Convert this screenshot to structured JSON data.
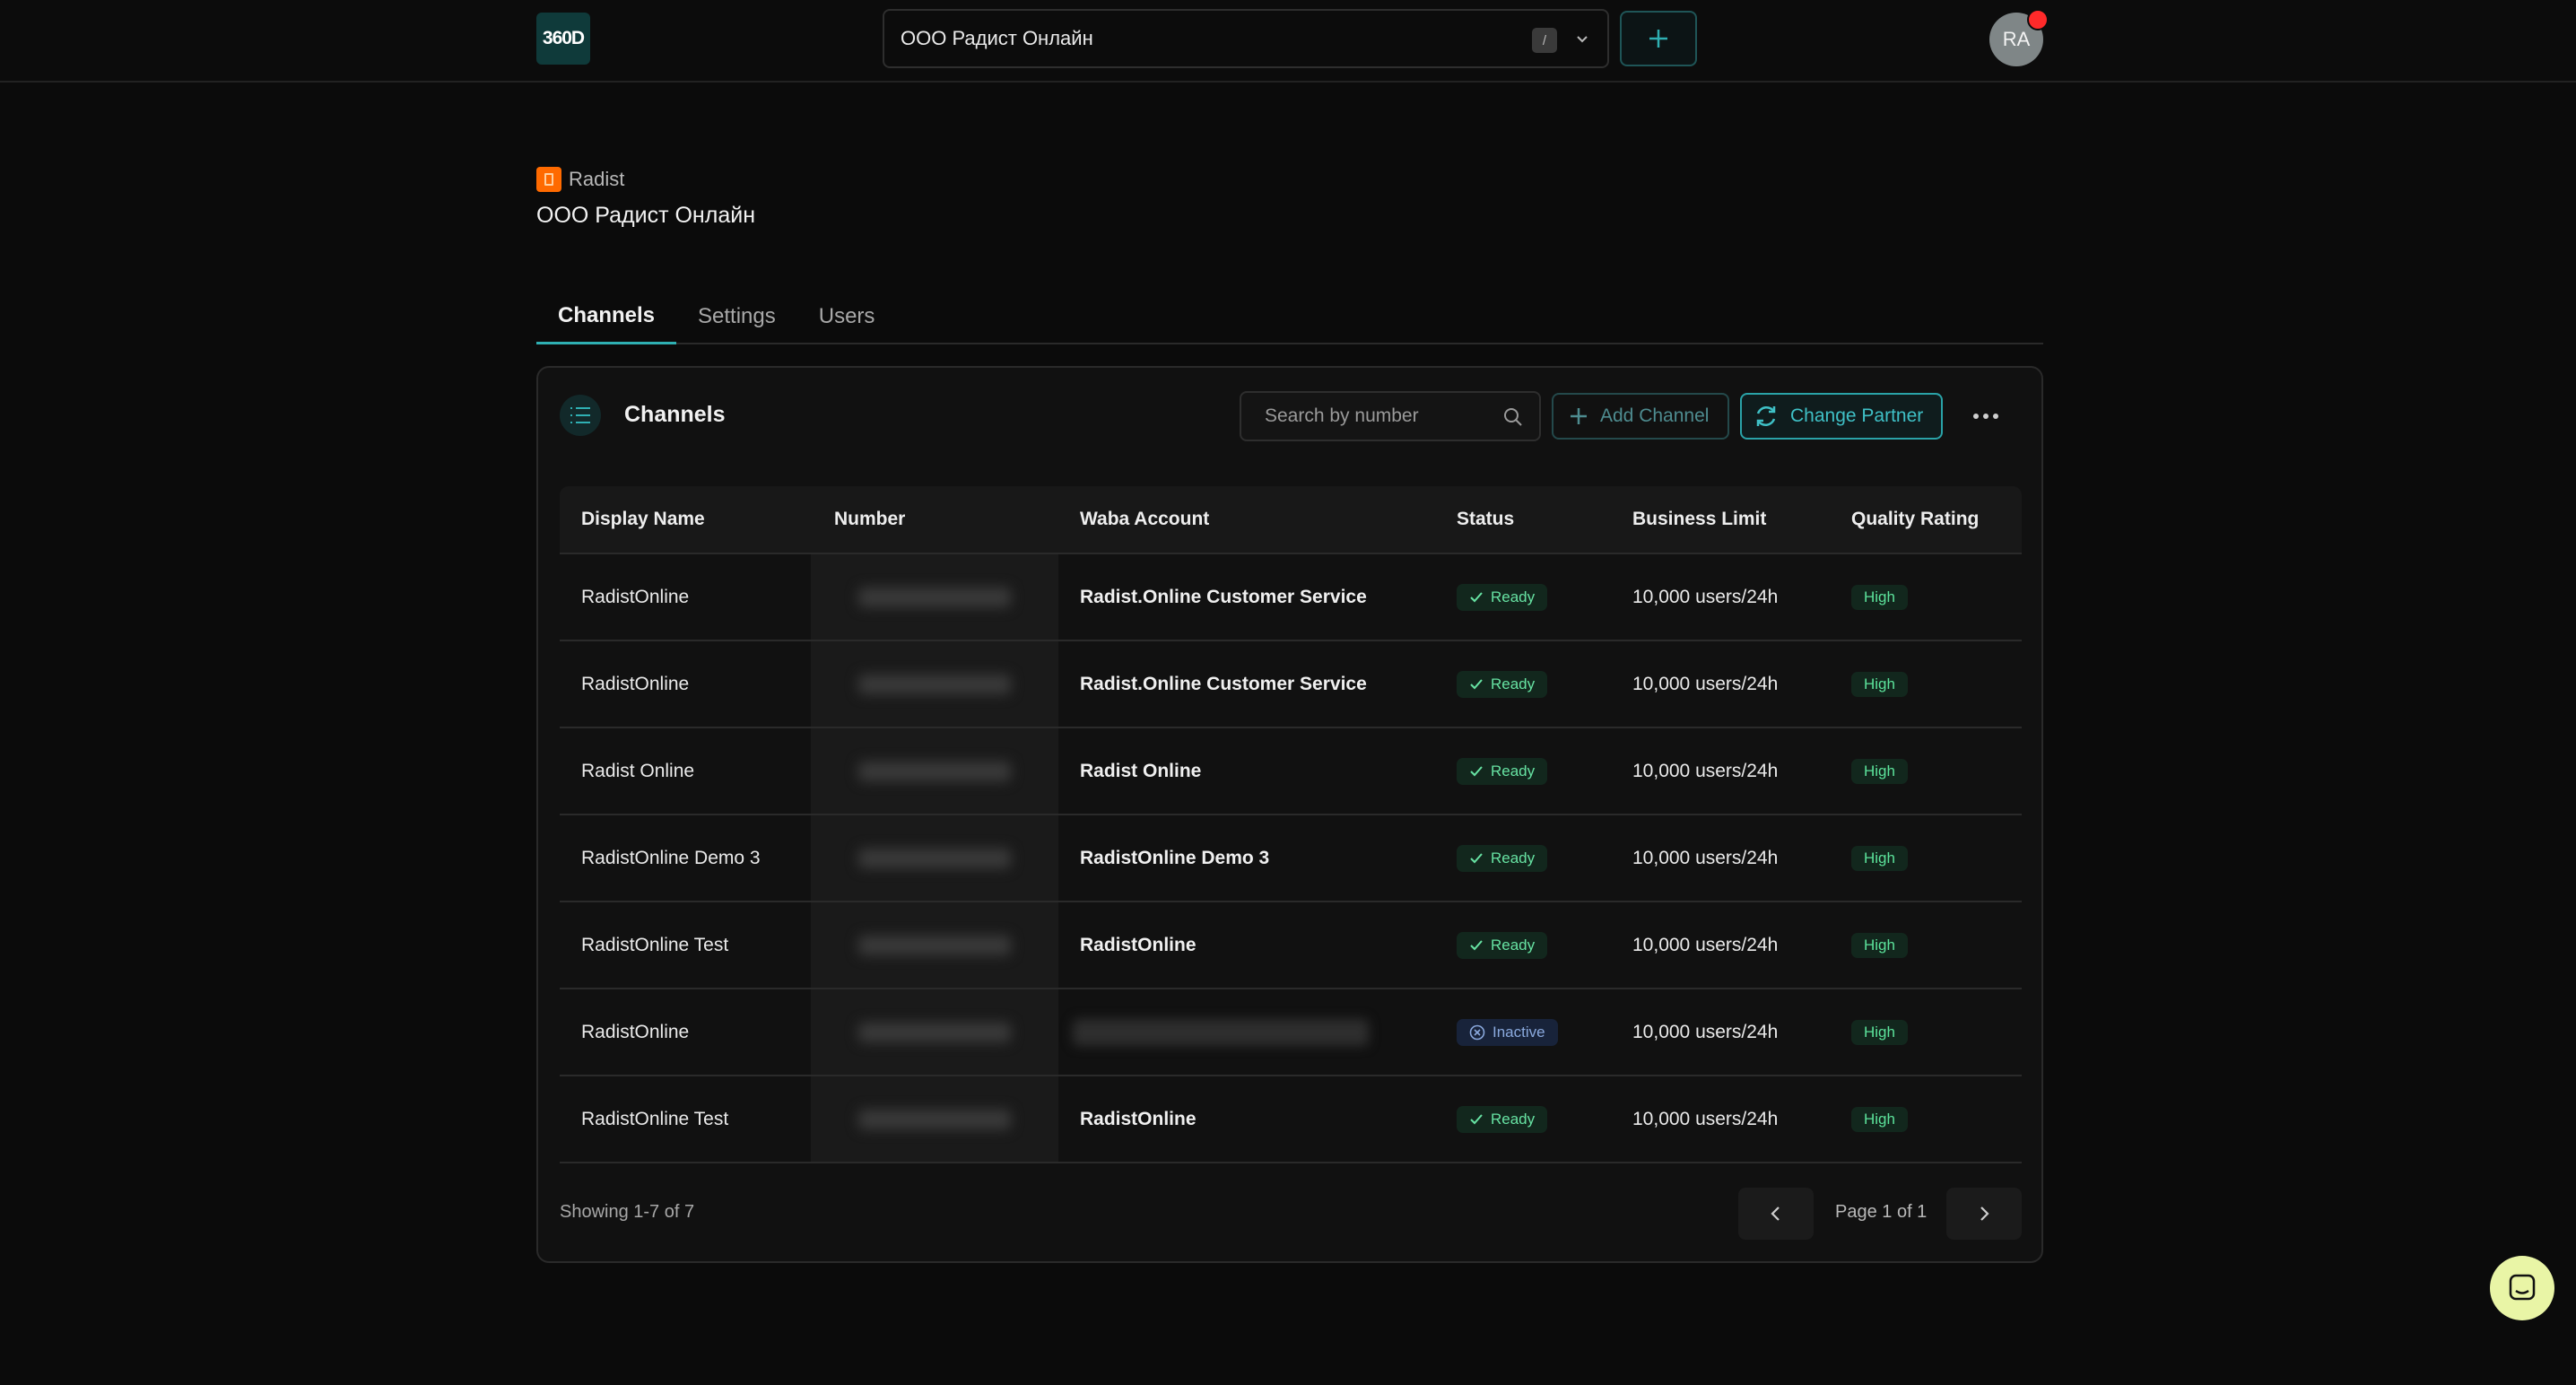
{
  "topbar": {
    "logo_text": "360D",
    "org_select": {
      "value": "ООО Радист Онлайн",
      "shortcut": "/"
    }
  },
  "user": {
    "initials": "RA"
  },
  "header": {
    "brand": "Radist",
    "title": "ООО Радист Онлайн"
  },
  "tabs": [
    {
      "label": "Channels",
      "active": true
    },
    {
      "label": "Settings",
      "active": false
    },
    {
      "label": "Users",
      "active": false
    }
  ],
  "card": {
    "title": "Channels",
    "search_placeholder": "Search by number",
    "add_channel_label": "Add Channel",
    "change_partner_label": "Change Partner"
  },
  "table": {
    "columns": [
      "Display Name",
      "Number",
      "Waba Account",
      "Status",
      "Business Limit",
      "Quality Rating"
    ],
    "rows": [
      {
        "display_name": "RadistOnline",
        "waba": "Radist.Online Customer Service",
        "status": "Ready",
        "limit": "10,000 users/24h",
        "quality": "High"
      },
      {
        "display_name": "RadistOnline",
        "waba": "Radist.Online Customer Service",
        "status": "Ready",
        "limit": "10,000 users/24h",
        "quality": "High"
      },
      {
        "display_name": "Radist Online",
        "waba": "Radist Online",
        "status": "Ready",
        "limit": "10,000 users/24h",
        "quality": "High"
      },
      {
        "display_name": "RadistOnline Demo 3",
        "waba": "RadistOnline Demo 3",
        "status": "Ready",
        "limit": "10,000 users/24h",
        "quality": "High"
      },
      {
        "display_name": "RadistOnline Test",
        "waba": "RadistOnline",
        "status": "Ready",
        "limit": "10,000 users/24h",
        "quality": "High"
      },
      {
        "display_name": "RadistOnline",
        "waba": "",
        "status": "Inactive",
        "limit": "10,000 users/24h",
        "quality": "High"
      },
      {
        "display_name": "RadistOnline Test",
        "waba": "RadistOnline",
        "status": "Ready",
        "limit": "10,000 users/24h",
        "quality": "High"
      }
    ]
  },
  "footer": {
    "showing": "Showing 1-7 of 7",
    "page_label": "Page 1 of 1"
  },
  "colors": {
    "accent": "#2fb0b3",
    "ready": "#67e3a3",
    "inactive": "#8aa9dd",
    "notification": "#ff2a2a",
    "brand": "#ff6a00"
  }
}
